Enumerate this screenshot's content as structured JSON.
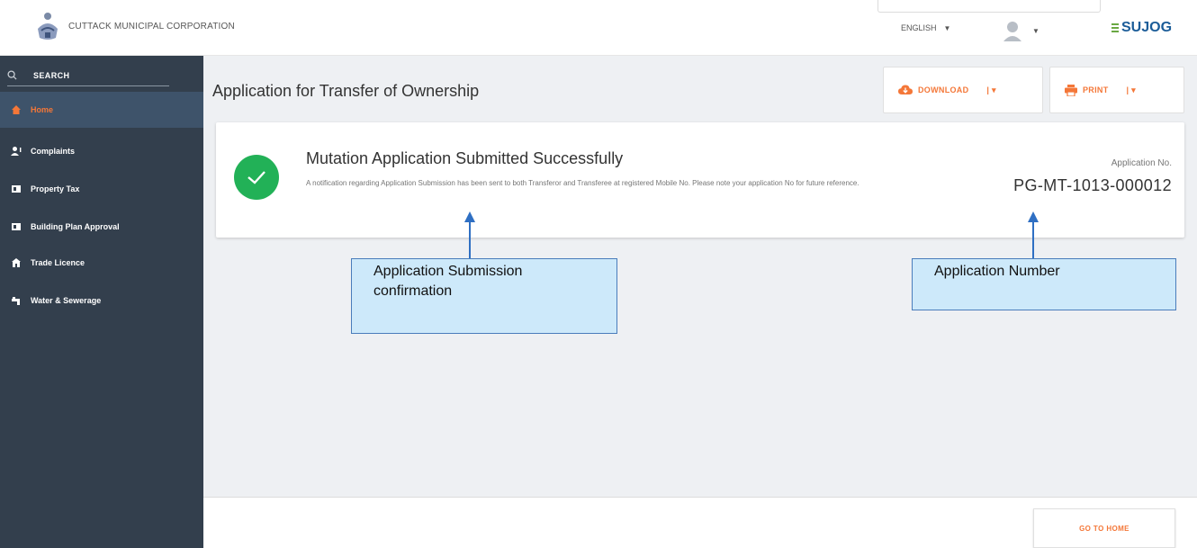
{
  "header": {
    "corporation_name": "CUTTACK MUNICIPAL CORPORATION",
    "language": "ENGLISH",
    "brand": "SUJOG"
  },
  "sidebar": {
    "search_label": "SEARCH",
    "items": [
      {
        "label": "Home",
        "icon": "home-icon",
        "active": true
      },
      {
        "label": "Complaints",
        "icon": "complaints-icon"
      },
      {
        "label": "Property Tax",
        "icon": "property-tax-icon"
      },
      {
        "label": "Building Plan Approval",
        "icon": "building-plan-icon"
      },
      {
        "label": "Trade Licence",
        "icon": "trade-licence-icon"
      },
      {
        "label": "Water & Sewerage",
        "icon": "water-icon"
      }
    ]
  },
  "main": {
    "title": "Application for Transfer of Ownership",
    "download_label": "DOWNLOAD",
    "print_label": "PRINT",
    "success_title": "Mutation Application Submitted Successfully",
    "success_message": "A notification regarding Application Submission has been sent to both Transferor and Transferee at registered Mobile No. Please note your application No for future reference.",
    "application_no_label": "Application No.",
    "application_no": "PG-MT-1013-000012"
  },
  "footer": {
    "go_home_label": "GO TO HOME"
  },
  "annotations": {
    "submission_callout": "Application Submission confirmation",
    "number_callout": "Application Number"
  },
  "colors": {
    "accent": "#f47738",
    "sidebar_bg": "#333f4d",
    "success": "#22b157",
    "brand": "#1b5c98",
    "callout_bg": "#cde9fa",
    "arrow": "#2f6fc3"
  }
}
